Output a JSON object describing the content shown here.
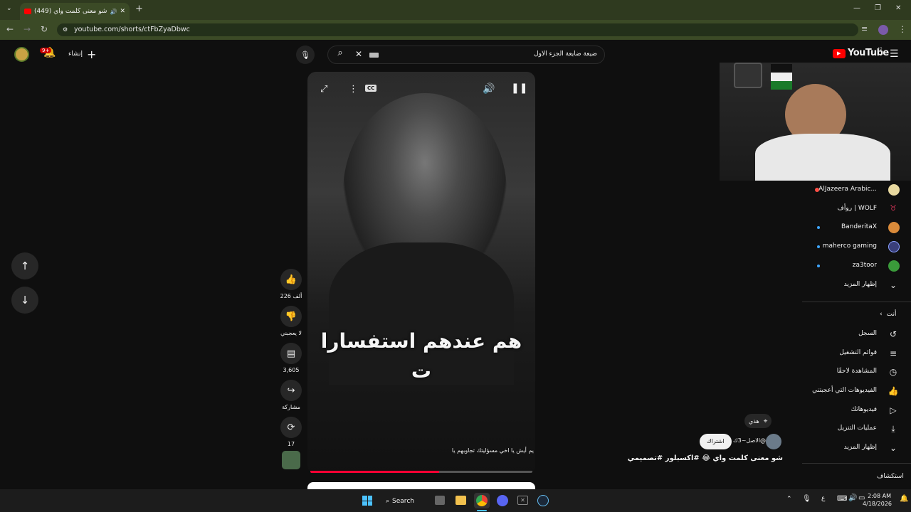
{
  "browser": {
    "tab_title": "(449) شو معنى كلمت واي 😂",
    "url": "youtube.com/shorts/ctFbZyaDbwc"
  },
  "header": {
    "logo": "YouTube",
    "logo_sup": "JO",
    "search_value": "ضيعة ضايعة الجزء الاول",
    "create_label": "إنشاء",
    "notif_badge": "9+"
  },
  "video": {
    "caption": "هم عندهم استفسارا ت",
    "cc": "CC",
    "comment_preview": "يم أيش يا اخي مسؤليتك تجاوبهم يا",
    "title": "شو معنى كلمت واي 😂 #اكسبلور #تصميمي",
    "channel": "@الاصل~3ك",
    "subscribe": "اشتراك",
    "location": "هذي",
    "progress": 0.58
  },
  "actions": {
    "likes": "226 ألف",
    "dislike": "لا يعجبني",
    "comments": "3,605",
    "share": "مشاركة",
    "remix": "17"
  },
  "sidebar": {
    "subs": [
      {
        "name": "AlJazeera Arabic..."
      },
      {
        "name": "روأف | WOLF"
      },
      {
        "name": "BanderitaX"
      },
      {
        "name": "maherco gaming"
      },
      {
        "name": "za3toor"
      }
    ],
    "show_more_1": "إظهار المزيد",
    "you_title": "أنت",
    "you_items": [
      {
        "label": "السجل"
      },
      {
        "label": "قوائم التشغيل"
      },
      {
        "label": "المشاهدة لاحقًا"
      },
      {
        "label": "الفيديوهات التي أعجبتني"
      },
      {
        "label": "فيديوهاتك"
      },
      {
        "label": "عمليات التنزيل"
      }
    ],
    "show_more_2": "إظهار المزيد",
    "explore": "استكشاف"
  },
  "taskbar": {
    "search": "Search",
    "time": "2:08 AM",
    "date": "4/18/2026",
    "lang": "ع"
  },
  "colors": {
    "accent": "#ff0000",
    "chrome": "#2f3a1f"
  }
}
